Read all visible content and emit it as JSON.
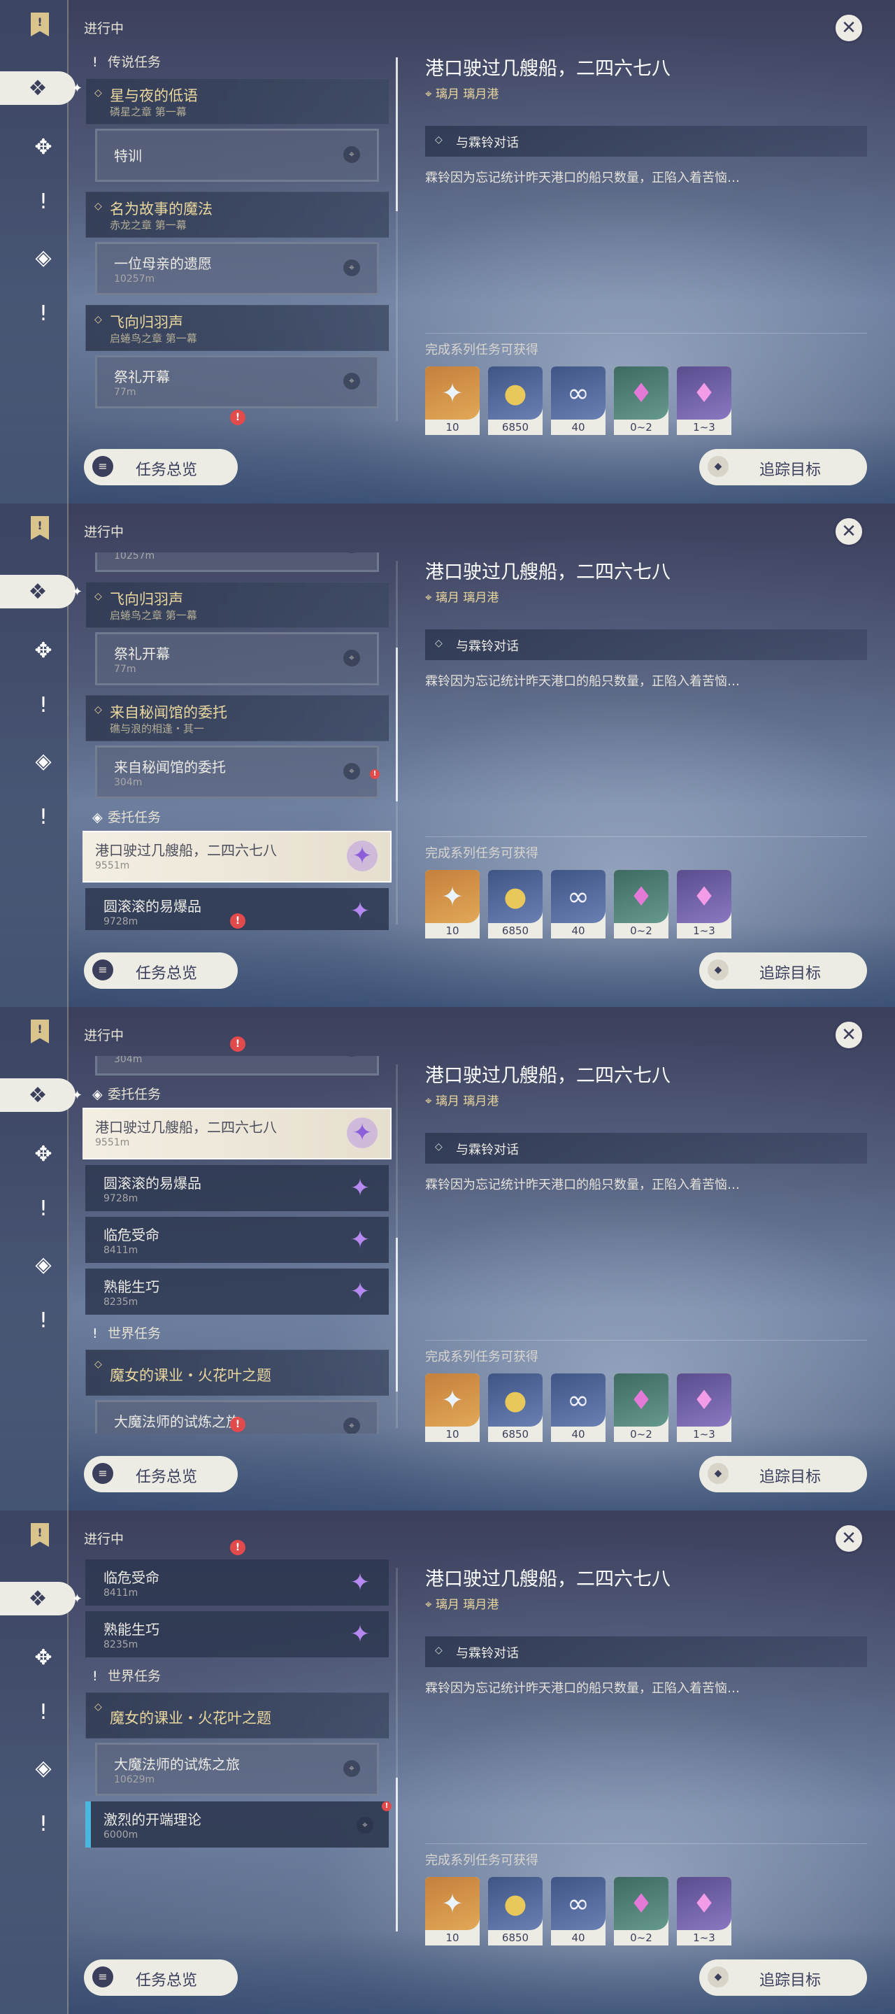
{
  "labels": {
    "status": "进行中",
    "overview": "任务总览",
    "track": "追踪目标",
    "rewards_title": "完成系列任务可获得",
    "sec_legend": "传说任务",
    "sec_commission": "委托任务",
    "sec_world": "世界任务"
  },
  "detail": {
    "title": "港口驶过几艘船，二四六七八",
    "location": "璃月 璃月港",
    "objective": "与霖铃对话",
    "description": "霖铃因为忘记统计昨天港口的船只数量，正陷入着苦恼…"
  },
  "rewards": [
    {
      "icon": "primogem-icon",
      "qty": "10",
      "color": "orange"
    },
    {
      "icon": "mora-icon",
      "qty": "6850",
      "color": "blue"
    },
    {
      "icon": "companionship-exp-icon",
      "qty": "40",
      "color": "blue"
    },
    {
      "icon": "crystal-chunk-icon",
      "qty": "0~2",
      "color": "green"
    },
    {
      "icon": "purple-crystal-icon",
      "qty": "1~3",
      "color": "purple"
    }
  ],
  "quests": {
    "legend1": {
      "title": "星与夜的低语",
      "sub": "磷星之章 第一幕",
      "step": "特训"
    },
    "legend2": {
      "title": "名为故事的魔法",
      "sub": "赤龙之章 第一幕",
      "step": "一位母亲的遗愿",
      "step_dist": "10257m"
    },
    "legend3": {
      "title": "飞向归羽声",
      "sub": "启蜷鸟之章 第一幕",
      "step": "祭礼开幕",
      "step_dist": "77m"
    },
    "legend4": {
      "title": "来自秘闻馆的委托",
      "sub": "礁与浪的相逢・其一",
      "step": "来自秘闻馆的委托",
      "step_dist": "304m"
    },
    "com1": {
      "title": "港口驶过几艘船，二四六七八",
      "dist": "9551m"
    },
    "com2": {
      "title": "圆滚滚的易爆品",
      "dist": "9728m"
    },
    "com3": {
      "title": "临危受命",
      "dist": "8411m"
    },
    "com4": {
      "title": "熟能生巧",
      "dist": "8235m"
    },
    "world1": {
      "title": "魔女的课业・火花叶之题",
      "step": "大魔法师的试炼之旅",
      "step_dist": "10629m"
    },
    "world2": {
      "title": "激烈的开端理论",
      "dist": "6000m"
    }
  }
}
